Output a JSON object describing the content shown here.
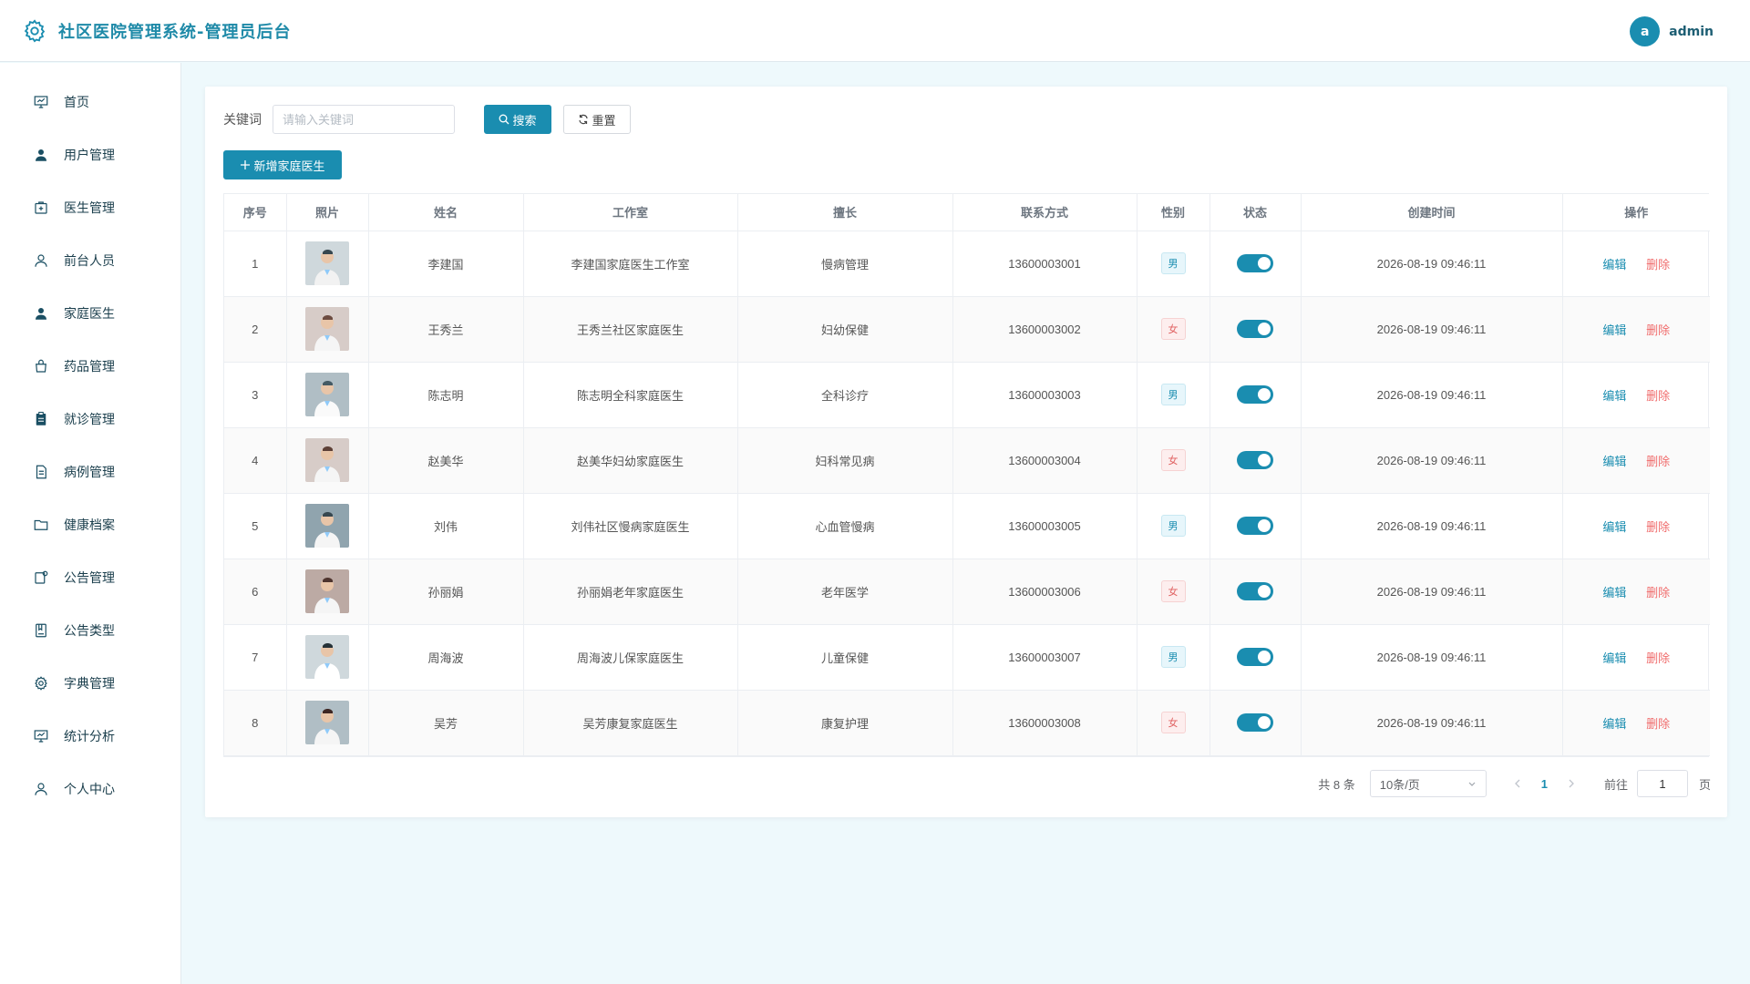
{
  "header": {
    "title": "社区医院管理系统-管理员后台",
    "avatar_letter": "a",
    "username": "admin"
  },
  "sidebar": {
    "items": [
      {
        "label": "首页",
        "icon": "dashboard-icon"
      },
      {
        "label": "用户管理",
        "icon": "user-filled-icon"
      },
      {
        "label": "医生管理",
        "icon": "medical-box-icon"
      },
      {
        "label": "前台人员",
        "icon": "user-outline-icon"
      },
      {
        "label": "家庭医生",
        "icon": "user-filled-icon"
      },
      {
        "label": "药品管理",
        "icon": "bag-icon"
      },
      {
        "label": "就诊管理",
        "icon": "clipboard-icon"
      },
      {
        "label": "病例管理",
        "icon": "document-icon"
      },
      {
        "label": "健康档案",
        "icon": "folder-icon"
      },
      {
        "label": "公告管理",
        "icon": "notice-icon"
      },
      {
        "label": "公告类型",
        "icon": "notebook-icon"
      },
      {
        "label": "字典管理",
        "icon": "gear-icon"
      },
      {
        "label": "统计分析",
        "icon": "chart-icon"
      },
      {
        "label": "个人中心",
        "icon": "user-outline-icon"
      }
    ]
  },
  "search": {
    "label": "关键词",
    "placeholder": "请输入关键词",
    "search_label": "搜索",
    "reset_label": "重置"
  },
  "add_label": "新增家庭医生",
  "table": {
    "headers": [
      "序号",
      "照片",
      "姓名",
      "工作室",
      "擅长",
      "联系方式",
      "性别",
      "状态",
      "创建时间",
      "操作"
    ],
    "rows": [
      {
        "index": "1",
        "name": "李建国",
        "studio": "李建国家庭医生工作室",
        "specialty": "慢病管理",
        "phone": "13600003001",
        "gender": "男",
        "created": "2026-08-19 09:46:11"
      },
      {
        "index": "2",
        "name": "王秀兰",
        "studio": "王秀兰社区家庭医生",
        "specialty": "妇幼保健",
        "phone": "13600003002",
        "gender": "女",
        "created": "2026-08-19 09:46:11"
      },
      {
        "index": "3",
        "name": "陈志明",
        "studio": "陈志明全科家庭医生",
        "specialty": "全科诊疗",
        "phone": "13600003003",
        "gender": "男",
        "created": "2026-08-19 09:46:11"
      },
      {
        "index": "4",
        "name": "赵美华",
        "studio": "赵美华妇幼家庭医生",
        "specialty": "妇科常见病",
        "phone": "13600003004",
        "gender": "女",
        "created": "2026-08-19 09:46:11"
      },
      {
        "index": "5",
        "name": "刘伟",
        "studio": "刘伟社区慢病家庭医生",
        "specialty": "心血管慢病",
        "phone": "13600003005",
        "gender": "男",
        "created": "2026-08-19 09:46:11"
      },
      {
        "index": "6",
        "name": "孙丽娟",
        "studio": "孙丽娟老年家庭医生",
        "specialty": "老年医学",
        "phone": "13600003006",
        "gender": "女",
        "created": "2026-08-19 09:46:11"
      },
      {
        "index": "7",
        "name": "周海波",
        "studio": "周海波儿保家庭医生",
        "specialty": "儿童保健",
        "phone": "13600003007",
        "gender": "男",
        "created": "2026-08-19 09:46:11"
      },
      {
        "index": "8",
        "name": "吴芳",
        "studio": "吴芳康复家庭医生",
        "specialty": "康复护理",
        "phone": "13600003008",
        "gender": "女",
        "created": "2026-08-19 09:46:11"
      }
    ],
    "edit_label": "编辑",
    "delete_label": "删除",
    "status_on": true
  },
  "pagination": {
    "total_text": "共 8 条",
    "page_size": "10条/页",
    "current_page": "1",
    "goto_label": "前往",
    "goto_value": "1",
    "unit": "页"
  },
  "colors": {
    "accent": "#1a8db0",
    "danger": "#f06c6c",
    "background": "#eef9fc"
  }
}
